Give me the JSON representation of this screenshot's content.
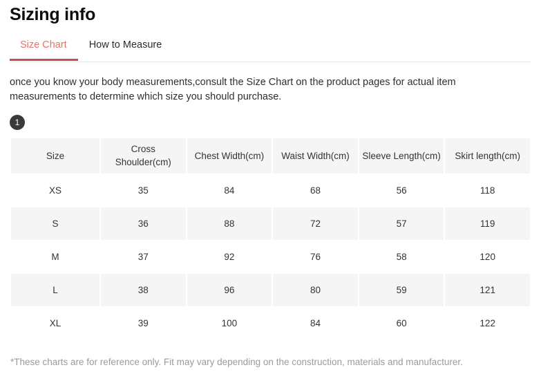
{
  "header": {
    "title": "Sizing info"
  },
  "tabs": {
    "active_index": 0,
    "active_color": "#e2756d",
    "underline_color": "#c0504d",
    "items": [
      {
        "label": "Size Chart"
      },
      {
        "label": "How to Measure"
      }
    ]
  },
  "intro": {
    "text": "once you know your body measurements,consult the Size Chart on the product pages for actual item measurements to determine which size you should purchase."
  },
  "step_badge": {
    "label": "1",
    "background": "#3a3a3a",
    "color": "#ffffff"
  },
  "table": {
    "header_background": "#f5f5f5",
    "stripe_background": "#f5f5f5",
    "columns": [
      "Size",
      "Cross Shoulder(cm)",
      "Chest Width(cm)",
      "Waist Width(cm)",
      "Sleeve Length(cm)",
      "Skirt length(cm)"
    ],
    "rows": [
      [
        "XS",
        "35",
        "84",
        "68",
        "56",
        "118"
      ],
      [
        "S",
        "36",
        "88",
        "72",
        "57",
        "119"
      ],
      [
        "M",
        "37",
        "92",
        "76",
        "58",
        "120"
      ],
      [
        "L",
        "38",
        "96",
        "80",
        "59",
        "121"
      ],
      [
        "XL",
        "39",
        "100",
        "84",
        "60",
        "122"
      ]
    ]
  },
  "footnote": {
    "text": "*These charts are for reference only. Fit may vary depending on the construction, materials and manufacturer."
  }
}
